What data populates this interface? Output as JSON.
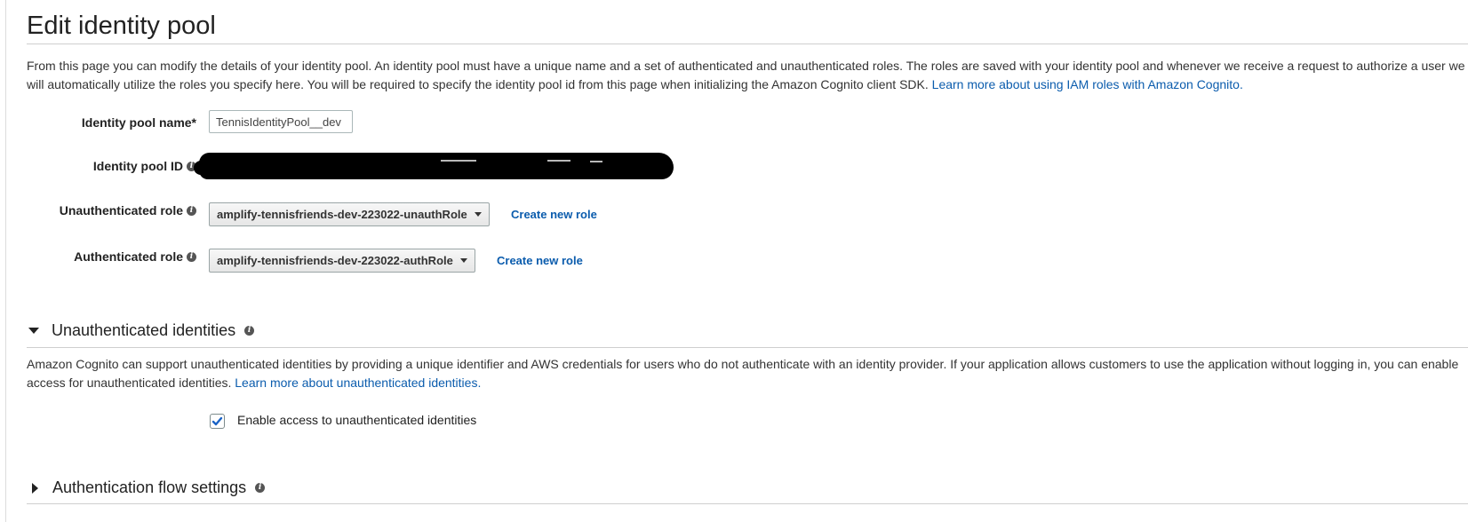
{
  "page": {
    "title": "Edit identity pool",
    "description": "From this page you can modify the details of your identity pool. An identity pool must have a unique name and a set of authenticated and unauthenticated roles. The roles are saved with your identity pool and whenever we receive a request to authorize a user we will automatically utilize the roles you specify here. You will be required to specify the identity pool id from this page when initializing the Amazon Cognito client SDK. ",
    "description_link": "Learn more about using IAM roles with Amazon Cognito."
  },
  "form": {
    "pool_name_label": "Identity pool name*",
    "pool_name_value": "TennisIdentityPool__dev",
    "pool_id_label": "Identity pool ID",
    "unauth_role_label": "Unauthenticated role",
    "unauth_role_value": "amplify-tennisfriends-dev-223022-unauthRole",
    "auth_role_label": "Authenticated role",
    "auth_role_value": "amplify-tennisfriends-dev-223022-authRole",
    "create_role_link": "Create new role"
  },
  "unauth_section": {
    "heading": "Unauthenticated identities",
    "body": "Amazon Cognito can support unauthenticated identities by providing a unique identifier and AWS credentials for users who do not authenticate with an identity provider. If your application allows customers to use the application without logging in, you can enable access for unauthenticated identities. ",
    "body_link": "Learn more about unauthenticated identities.",
    "checkbox_label": "Enable access to unauthenticated identities",
    "checkbox_checked": true
  },
  "auth_flow_section": {
    "heading": "Authentication flow settings"
  },
  "icons": {
    "info": "info-icon",
    "expanded": "triangle-down-icon",
    "collapsed": "triangle-right-icon",
    "dropdown": "caret-down-icon",
    "check": "checkmark-icon"
  },
  "colors": {
    "link": "#0b5cad",
    "checkmark": "#1a63c6"
  }
}
